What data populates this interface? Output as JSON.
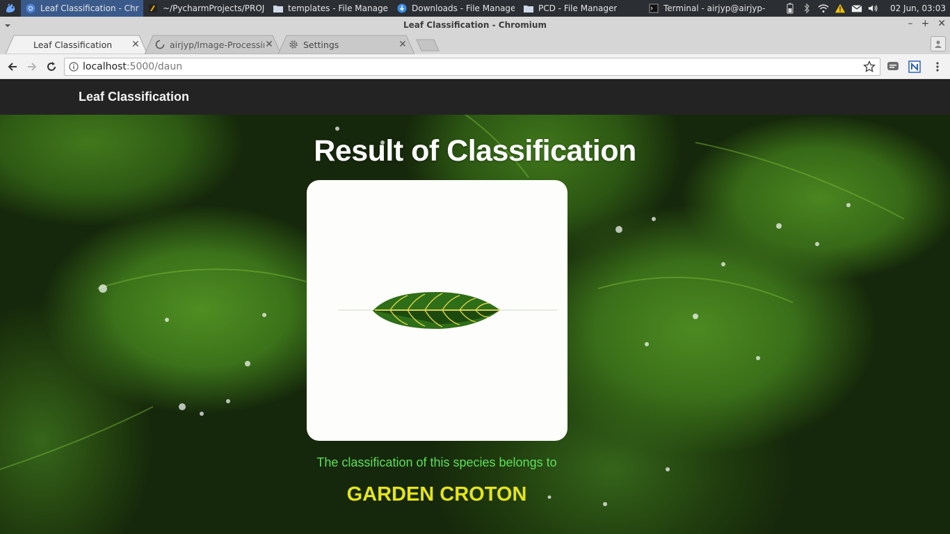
{
  "taskbar": {
    "tasks": [
      {
        "label": "Leaf Classification - Chro...",
        "icon": "chromium-icon",
        "active": true
      },
      {
        "label": "~/PycharmProjects/PROJ...",
        "icon": "pycharm-icon",
        "active": false
      },
      {
        "label": "templates - File Manager",
        "icon": "folder-icon",
        "active": false
      },
      {
        "label": "Downloads - File Manager",
        "icon": "download-icon",
        "active": false
      },
      {
        "label": "PCD - File Manager",
        "icon": "folder-icon",
        "active": false
      },
      {
        "label": "Terminal - airjyp@airjyp-...",
        "icon": "terminal-icon",
        "active": false
      }
    ],
    "clock": "02 Jun, 03:03"
  },
  "window": {
    "title": "Leaf Classification - Chromium"
  },
  "tabs": [
    {
      "title": "Leaf Classification",
      "active": true
    },
    {
      "title": "airjyp/Image-Processin",
      "active": false
    },
    {
      "title": "Settings",
      "active": false
    }
  ],
  "address_bar": {
    "host": "localhost",
    "path": ":5000/daun"
  },
  "page": {
    "brand": "Leaf Classification",
    "heading": "Result of Classification",
    "caption": "The classification of this species belongs to",
    "species": "GARDEN CROTON"
  },
  "colors": {
    "navbar": "#232323",
    "caption": "#5ee05a",
    "species": "#e4e41a",
    "taskbar_active": "#3a5a8c"
  }
}
